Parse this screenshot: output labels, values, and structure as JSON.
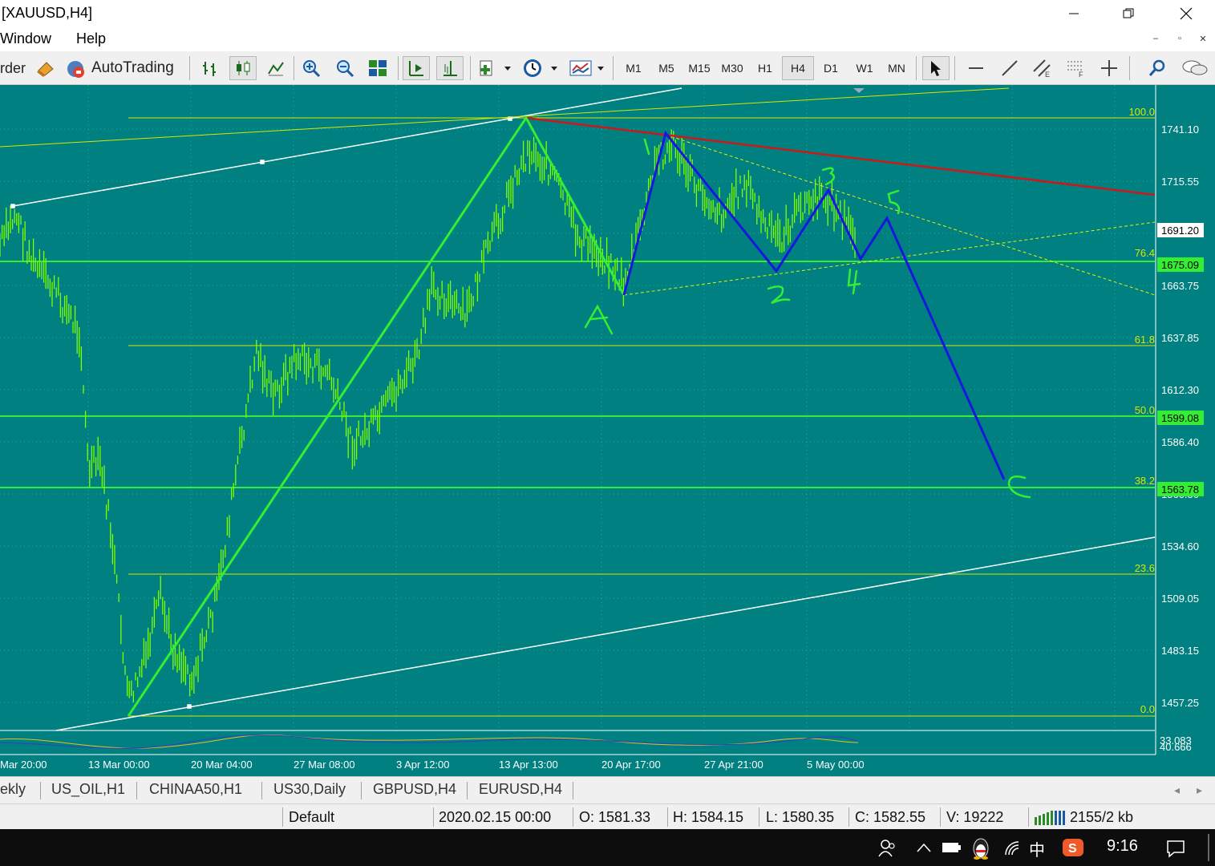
{
  "window": {
    "title": "[XAUUSD,H4]"
  },
  "menu": {
    "items": [
      "Window",
      "Help"
    ]
  },
  "toolbar": {
    "order_label": "rder",
    "autotrading_label": "AutoTrading",
    "timeframes": [
      "M1",
      "M5",
      "M15",
      "M30",
      "H1",
      "H4",
      "D1",
      "W1",
      "MN"
    ],
    "active_timeframe": "H4"
  },
  "chart": {
    "background_color": "#008080",
    "candle_color": "#7fff00",
    "price_labels": [
      "1741.10",
      "1715.55",
      "1691.20",
      "1663.75",
      "1637.85",
      "1612.30",
      "1586.40",
      "1560.50",
      "1534.60",
      "1509.05",
      "1483.15",
      "1457.25"
    ],
    "highlighted_prices": {
      "current": "1691.20",
      "fib_76": "1675.09",
      "fib_50": "1599.08",
      "fib_38": "1563.78"
    },
    "fib_levels": [
      "100.0",
      "76.4",
      "61.8",
      "50.0",
      "38.2",
      "23.6",
      "0.0"
    ],
    "date_labels": [
      "Mar 20:00",
      "13 Mar 00:00",
      "20 Mar 04:00",
      "27 Mar 08:00",
      "3 Apr 12:00",
      "13 Apr 13:00",
      "20 Apr 17:00",
      "27 Apr 21:00",
      "5 May 00:00"
    ],
    "indicator_labels": [
      "33.083",
      "40.666"
    ],
    "wave_labels": [
      "A",
      "1",
      "2",
      "3",
      "4",
      "5",
      "C"
    ]
  },
  "tabs": {
    "items": [
      "ekly",
      "US_OIL,H1",
      "CHINAA50,H1",
      "US30,Daily",
      "GBPUSD,H4",
      "EURUSD,H4"
    ]
  },
  "status": {
    "profile": "Default",
    "datetime": "2020.02.15 00:00",
    "open": "O: 1581.33",
    "high": "H: 1584.15",
    "low": "L: 1580.35",
    "close": "C: 1582.55",
    "volume": "V: 19222",
    "traffic": "2155/2 kb"
  },
  "taskbar": {
    "ime": "中",
    "clock": "9:16"
  }
}
